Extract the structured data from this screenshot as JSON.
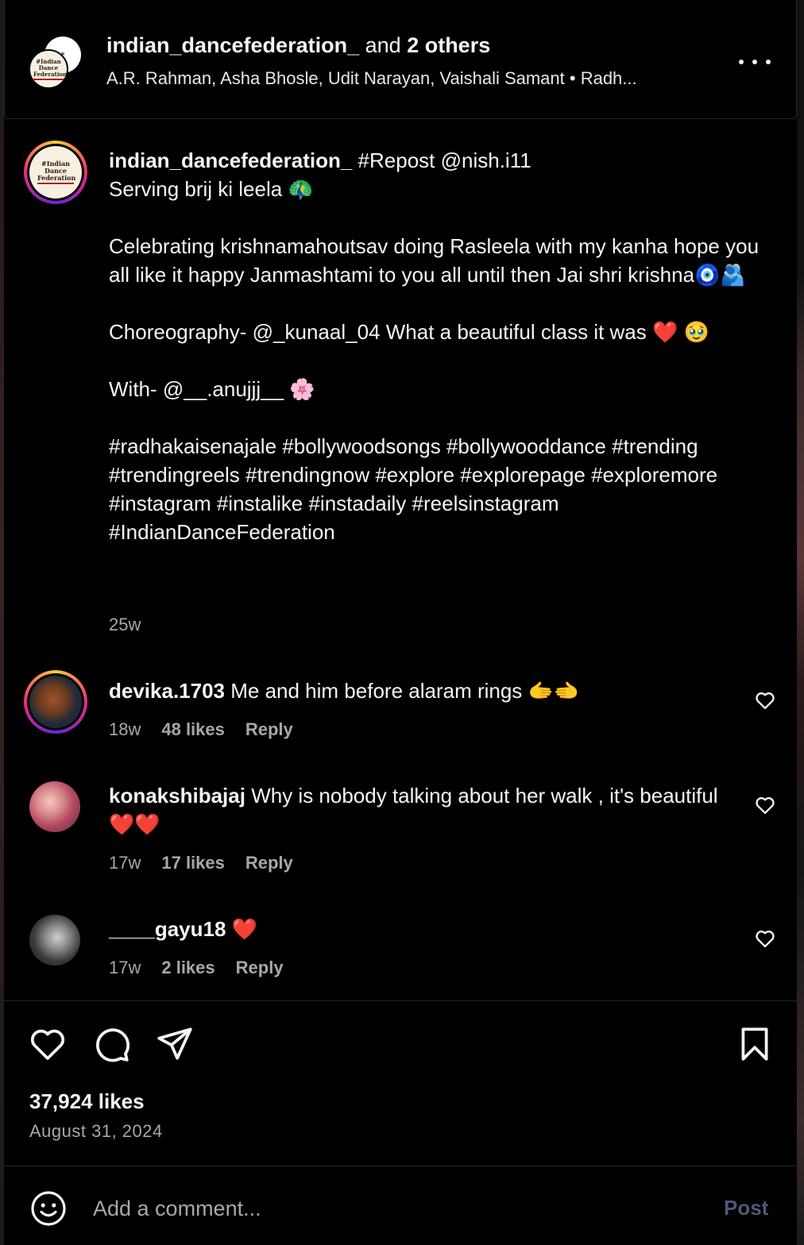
{
  "header": {
    "account": "indian_dancefederation_",
    "and_text": "and",
    "others": "2 others",
    "audio_line": "A.R. Rahman, Asha Bhosle, Udit Narayan, Vaishali Samant  •  Radh..."
  },
  "logo_text": "#Indian Dance Federation",
  "caption": {
    "username": "indian_dancefederation_",
    "first_line_rest": " #Repost @nish.i11",
    "line2": "Serving brij ki leela 🦚",
    "para1": "Celebrating krishnamahoutsav doing Rasleela with my kanha hope you all like it happy Janmashtami to you all until then Jai shri krishna🧿🫂",
    "para2": "Choreography- @_kunaal_04 What a beautiful class it was ❤️ 🥹",
    "para3": "With- @__.anujjj__ 🌸",
    "hashtags": "#radhakaisenajale #bollywoodsongs #bollywooddance #trending #trendingreels #trendingnow #explore #explorepage #exploremore #instagram #instalike #instadaily #reelsinstagram #IndianDanceFederation",
    "time": "25w"
  },
  "comments": [
    {
      "username": "devika.1703",
      "text": " Me and him before alaram rings 🫱🫲",
      "time": "18w",
      "likes": "48 likes",
      "reply": "Reply"
    },
    {
      "username": "konakshibajaj",
      "text": " Why is nobody talking about her walk , it's beautiful ❤️❤️",
      "time": "17w",
      "likes": "17 likes",
      "reply": "Reply"
    },
    {
      "username": "____gayu18",
      "text": " ❤️",
      "time": "17w",
      "likes": "2 likes",
      "reply": "Reply"
    }
  ],
  "likes_count": "37,924 likes",
  "post_date": "August 31, 2024",
  "add_comment": {
    "placeholder": "Add a comment...",
    "post_label": "Post"
  },
  "colors": {
    "background": "#000000",
    "text": "#f5f5f5",
    "secondary": "#a8a8a8",
    "post_disabled": "#4a5a78"
  }
}
